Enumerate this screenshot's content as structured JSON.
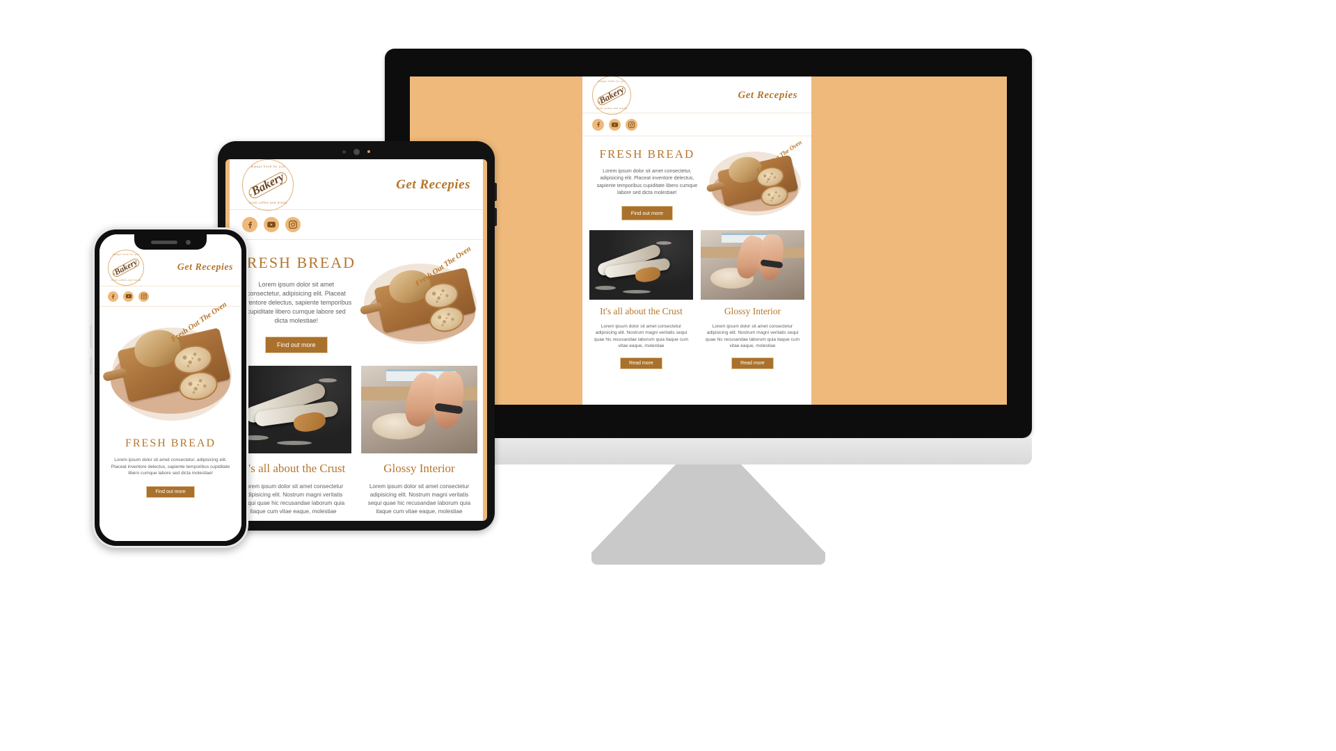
{
  "brand": {
    "logo_word": "Bakery",
    "logo_arc_top": "always fresh for you",
    "logo_arc_bottom": "fresh coffee and bread",
    "accent_brown": "#b5762c",
    "button_brown": "#a9712c",
    "page_bg_tan": "#eeb97a",
    "social_circle": "#eeb97a"
  },
  "header": {
    "nav_link": "Get Recepies"
  },
  "social": [
    {
      "name": "facebook",
      "label": "Facebook"
    },
    {
      "name": "youtube",
      "label": "YouTube"
    },
    {
      "name": "instagram",
      "label": "Instagram"
    }
  ],
  "hero": {
    "title": "FRESH BREAD",
    "body": "Lorem ipsum dolor sit amet consectetur, adipisicing elit. Placeat inventore delectus, sapiente temporibus cupiditate libero cumque labore sed dicta molestiae!",
    "button": "Find out more",
    "image_script": "Fresh Out The Oven",
    "image_alt": "bread loaf and slices on wooden board"
  },
  "cards": [
    {
      "title": "It's all about the Crust",
      "body": "Lorem ipsum dolor sit amet consectetur adipisicing elit. Nostrum magni veritatis sequi quae hic recusandae laborum quia itaque cum vitae eaque, molestiae",
      "button": "Read more",
      "image_alt": "baguettes dusted with flour on dark surface"
    },
    {
      "title": "Glossy Interior",
      "body": "Lorem ipsum dolor sit amet consectetur adipisicing elit. Nostrum magni veritatis sequi quae hic recusandae laborum quia itaque cum vitae eaque, molestiae",
      "button": "Read more",
      "image_alt": "hands kneading dough on floured counter"
    }
  ],
  "devices": {
    "desktop": "desktop monitor mockup",
    "tablet": "tablet mockup",
    "phone": "smartphone mockup"
  }
}
